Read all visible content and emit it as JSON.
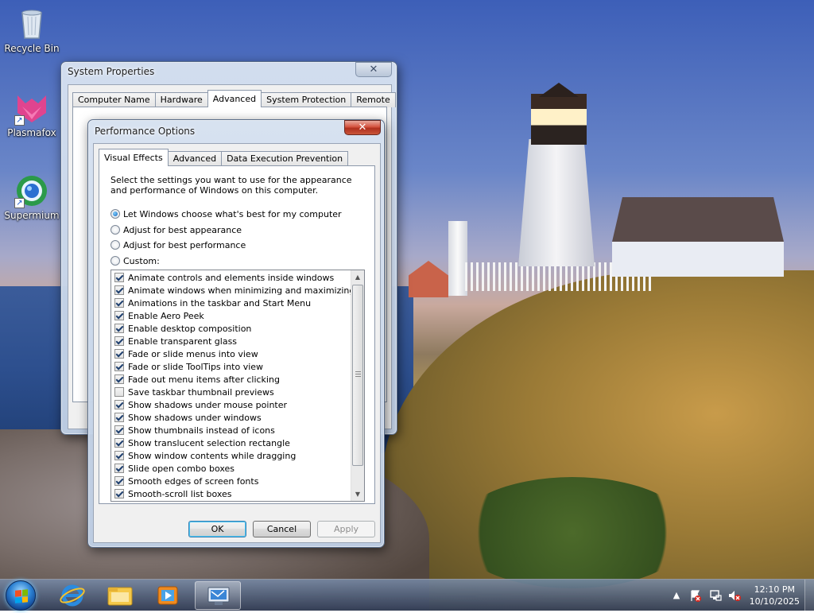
{
  "desktop": {
    "icons": [
      {
        "label": "Recycle Bin",
        "icon": "recycle-bin-icon"
      },
      {
        "label": "Plasmafox",
        "icon": "plasmafox-icon"
      },
      {
        "label": "Supermium",
        "icon": "supermium-icon"
      }
    ]
  },
  "system_properties": {
    "title": "System Properties",
    "close_label": "✕",
    "tabs": [
      "Computer Name",
      "Hardware",
      "Advanced",
      "System Protection",
      "Remote"
    ],
    "active_tab": "Advanced"
  },
  "performance_options": {
    "title": "Performance Options",
    "close_label": "✕",
    "tabs": [
      "Visual Effects",
      "Advanced",
      "Data Execution Prevention"
    ],
    "active_tab": "Visual Effects",
    "description": "Select the settings you want to use for the appearance and performance of Windows on this computer.",
    "radios": [
      {
        "label": "Let Windows choose what's best for my computer",
        "selected": true
      },
      {
        "label": "Adjust for best appearance",
        "selected": false
      },
      {
        "label": "Adjust for best performance",
        "selected": false
      },
      {
        "label": "Custom:",
        "selected": false
      }
    ],
    "effects": [
      {
        "label": "Animate controls and elements inside windows",
        "checked": true
      },
      {
        "label": "Animate windows when minimizing and maximizing",
        "checked": true
      },
      {
        "label": "Animations in the taskbar and Start Menu",
        "checked": true
      },
      {
        "label": "Enable Aero Peek",
        "checked": true
      },
      {
        "label": "Enable desktop composition",
        "checked": true
      },
      {
        "label": "Enable transparent glass",
        "checked": true
      },
      {
        "label": "Fade or slide menus into view",
        "checked": true
      },
      {
        "label": "Fade or slide ToolTips into view",
        "checked": true
      },
      {
        "label": "Fade out menu items after clicking",
        "checked": true
      },
      {
        "label": "Save taskbar thumbnail previews",
        "checked": false
      },
      {
        "label": "Show shadows under mouse pointer",
        "checked": true
      },
      {
        "label": "Show shadows under windows",
        "checked": true
      },
      {
        "label": "Show thumbnails instead of icons",
        "checked": true
      },
      {
        "label": "Show translucent selection rectangle",
        "checked": true
      },
      {
        "label": "Show window contents while dragging",
        "checked": true
      },
      {
        "label": "Slide open combo boxes",
        "checked": true
      },
      {
        "label": "Smooth edges of screen fonts",
        "checked": true
      },
      {
        "label": "Smooth-scroll list boxes",
        "checked": true
      }
    ],
    "buttons": {
      "ok": "OK",
      "cancel": "Cancel",
      "apply": "Apply"
    }
  },
  "taskbar": {
    "pinned": [
      "internet-explorer-icon",
      "file-explorer-icon",
      "media-player-icon",
      "system-properties-icon"
    ],
    "clock": {
      "time": "12:10 PM",
      "date": "10/10/2025"
    },
    "tray": {
      "chevron": "▲"
    }
  },
  "colors": {
    "accent": "#3c7fb1",
    "close_red": "#c9553a"
  }
}
